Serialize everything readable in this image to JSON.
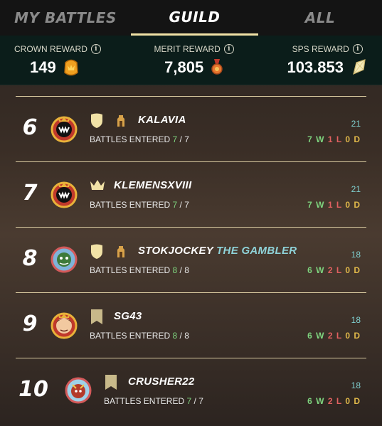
{
  "tabs": [
    {
      "label": "MY BATTLES",
      "active": false
    },
    {
      "label": "GUILD",
      "active": true
    },
    {
      "label": "ALL",
      "active": false
    }
  ],
  "rewards": {
    "crown": {
      "title": "CROWN REWARD",
      "value": "149",
      "icon": "crown-token-icon"
    },
    "merit": {
      "title": "MERIT REWARD",
      "value": "7,805",
      "icon": "merit-medal-icon"
    },
    "sps": {
      "title": "SPS REWARD",
      "value": "103.853",
      "icon": "sps-crystal-icon"
    }
  },
  "battles_label": "BATTLES ENTERED",
  "rows": [
    {
      "rank": "6",
      "name": "KALAVIA",
      "title": "",
      "entered": "7",
      "total": "7",
      "score": "21",
      "w": "7",
      "l": "1",
      "d": "0",
      "badge": "shield-icon",
      "has_title_icon": true
    },
    {
      "rank": "7",
      "name": "KLEMENSXVIII",
      "title": "",
      "entered": "7",
      "total": "7",
      "score": "21",
      "w": "7",
      "l": "1",
      "d": "0",
      "badge": "crown-icon",
      "has_title_icon": false
    },
    {
      "rank": "8",
      "name": "STOKJOCKEY",
      "title": "THE GAMBLER",
      "entered": "8",
      "total": "8",
      "score": "18",
      "w": "6",
      "l": "2",
      "d": "0",
      "badge": "shield-icon",
      "has_title_icon": true
    },
    {
      "rank": "9",
      "name": "SG43",
      "title": "",
      "entered": "8",
      "total": "8",
      "score": "18",
      "w": "6",
      "l": "2",
      "d": "0",
      "badge": "banner-icon",
      "has_title_icon": false
    },
    {
      "rank": "10",
      "name": "CRUSHER22",
      "title": "",
      "entered": "7",
      "total": "7",
      "score": "18",
      "w": "6",
      "l": "2",
      "d": "0",
      "badge": "banner-icon",
      "has_title_icon": false
    }
  ],
  "colors": {
    "accent": "#f1e2a6",
    "win": "#7ed37e",
    "loss": "#e06060",
    "draw": "#e0b84a",
    "score": "#7fcfcf",
    "title": "#8fd3d9"
  }
}
